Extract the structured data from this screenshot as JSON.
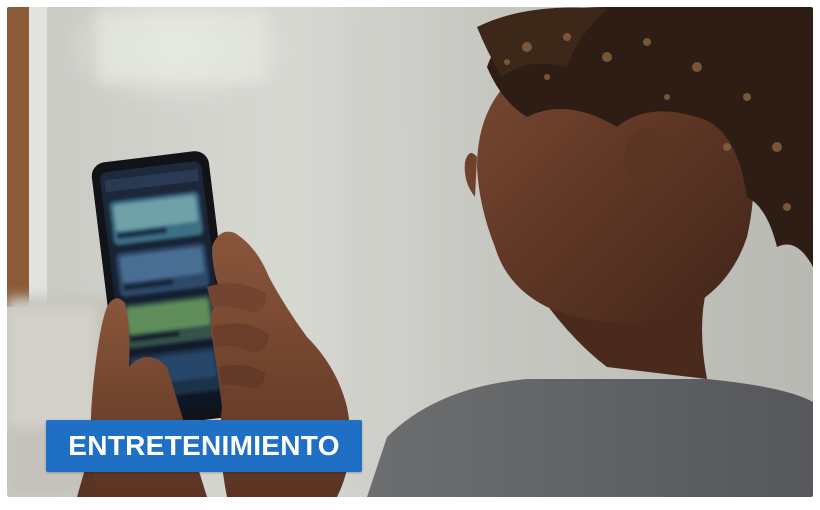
{
  "card": {
    "category_label": "ENTRETENIMIENTO",
    "image_subject": "person-using-smartphone-photo"
  },
  "colors": {
    "badge_background": "#1f6fc4",
    "badge_text": "#ffffff"
  }
}
